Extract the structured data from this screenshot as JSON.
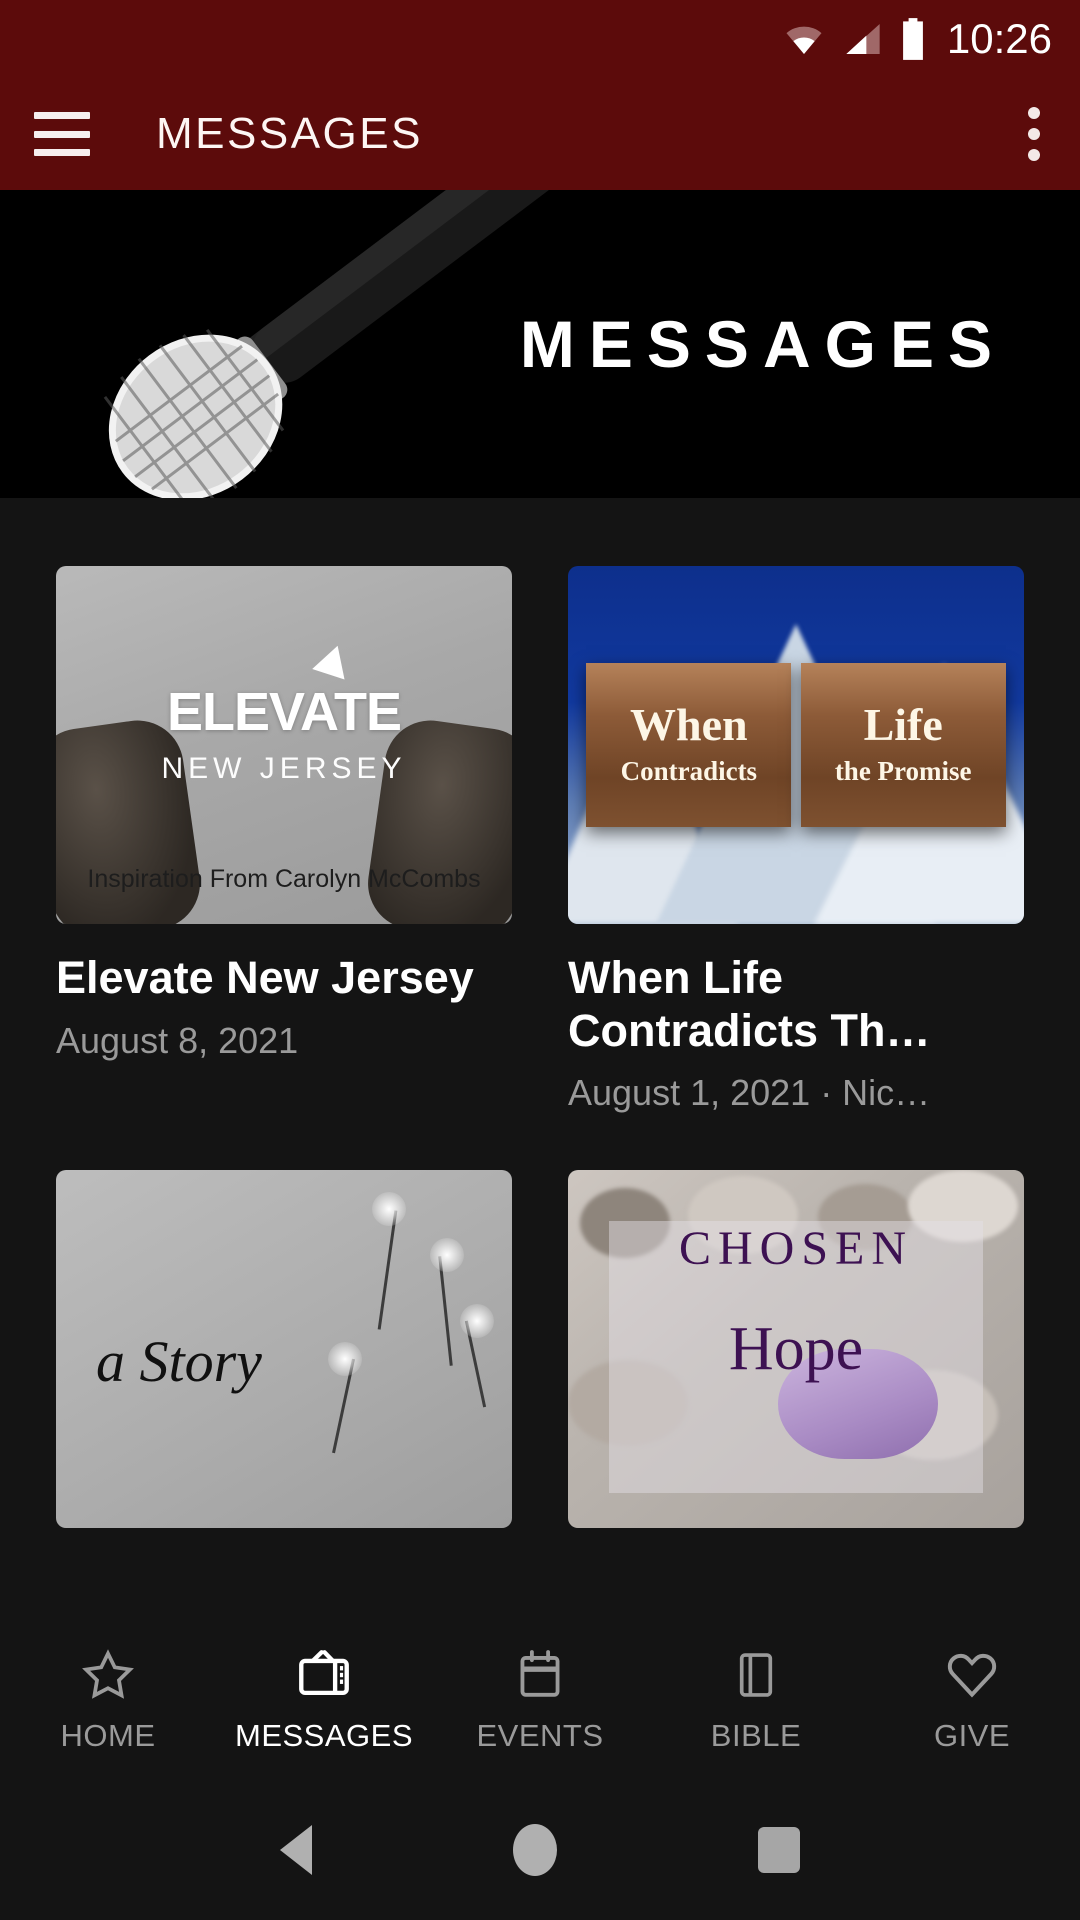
{
  "status_bar": {
    "time": "10:26",
    "icons": [
      "wifi-icon",
      "cellular-signal-icon",
      "battery-icon"
    ]
  },
  "app_bar": {
    "title": "MESSAGES",
    "menu_icon": "hamburger-menu-icon",
    "overflow_icon": "more-vert-icon",
    "background_color": "#5c0b0b"
  },
  "hero": {
    "title": "MESSAGES",
    "image_alt": "microphone-photo",
    "background_color": "#000000"
  },
  "cards": [
    {
      "title": "Elevate New Jersey",
      "meta": "August 8, 2021",
      "thumb": {
        "headline": "ELEVATE",
        "subhead": "NEW JERSEY",
        "caption": "Inspiration From Carolyn McCombs"
      }
    },
    {
      "title": "When Life Contradicts Th…",
      "meta": "August 1, 2021 · Nic…",
      "thumb": {
        "board_left_word": "When",
        "board_left_sub": "Contradicts",
        "board_right_word": "Life",
        "board_right_sub": "the Promise"
      }
    },
    {
      "title": "",
      "meta": "",
      "thumb": {
        "headline": "a Story"
      }
    },
    {
      "title": "",
      "meta": "",
      "thumb": {
        "headline": "CHOSEN",
        "subhead": "Hope"
      }
    }
  ],
  "tab_bar": {
    "items": [
      {
        "label": "HOME",
        "icon": "star-icon",
        "active": false
      },
      {
        "label": "MESSAGES",
        "icon": "tv-icon",
        "active": true
      },
      {
        "label": "EVENTS",
        "icon": "calendar-icon",
        "active": false
      },
      {
        "label": "BIBLE",
        "icon": "book-icon",
        "active": false
      },
      {
        "label": "GIVE",
        "icon": "heart-icon",
        "active": false
      }
    ],
    "active_color": "#ffffff",
    "inactive_color": "#9a9a9a"
  },
  "system_nav": {
    "back_icon": "back-triangle-icon",
    "home_icon": "home-circle-icon",
    "recents_icon": "recents-square-icon"
  }
}
